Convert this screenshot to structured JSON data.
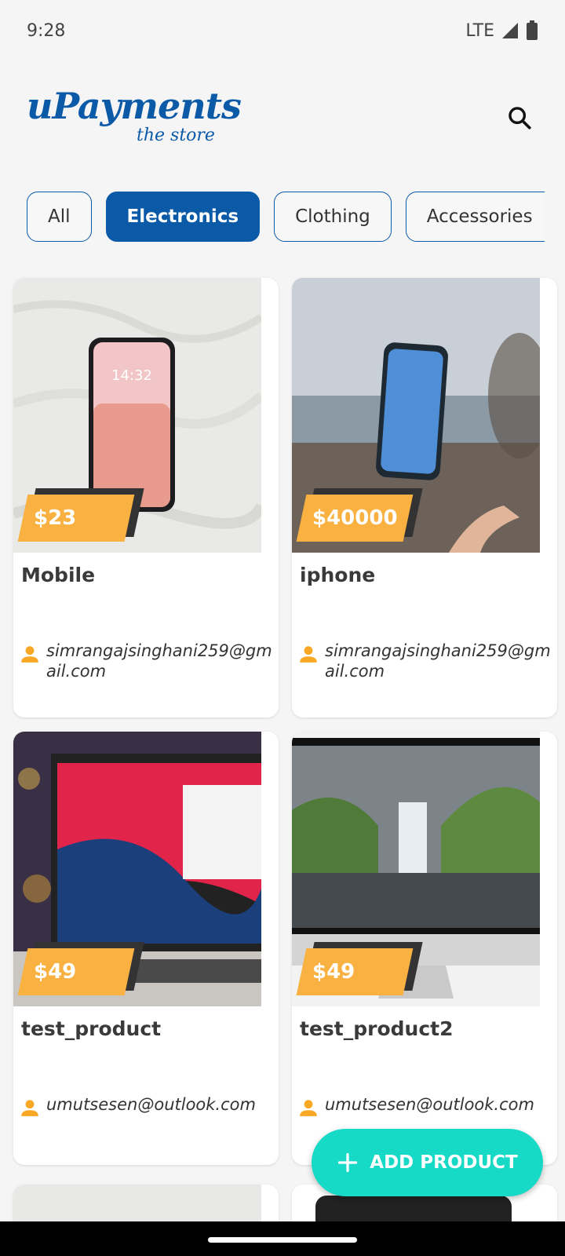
{
  "status": {
    "time": "9:28",
    "network": "LTE"
  },
  "header": {
    "logo_main": "uPayments",
    "logo_sub": "the store"
  },
  "categories": [
    {
      "label": "All",
      "active": false
    },
    {
      "label": "Electronics",
      "active": true
    },
    {
      "label": "Clothing",
      "active": false
    },
    {
      "label": "Accessories",
      "active": false
    }
  ],
  "products": [
    {
      "name": "Mobile",
      "price": "$23",
      "owner": "simrangajsinghani259@gmail.com"
    },
    {
      "name": "iphone",
      "price": "$40000",
      "owner": "simrangajsinghani259@gmail.com"
    },
    {
      "name": "test_product",
      "price": "$49",
      "owner": "umutsesen@outlook.com"
    },
    {
      "name": "test_product2",
      "price": "$49",
      "owner": "umutsesen@outlook.com"
    }
  ],
  "fab": {
    "label": "ADD PRODUCT"
  },
  "colors": {
    "brand": "#0b5aa8",
    "price_tag": "#f9b141",
    "fab": "#16d9c6"
  }
}
